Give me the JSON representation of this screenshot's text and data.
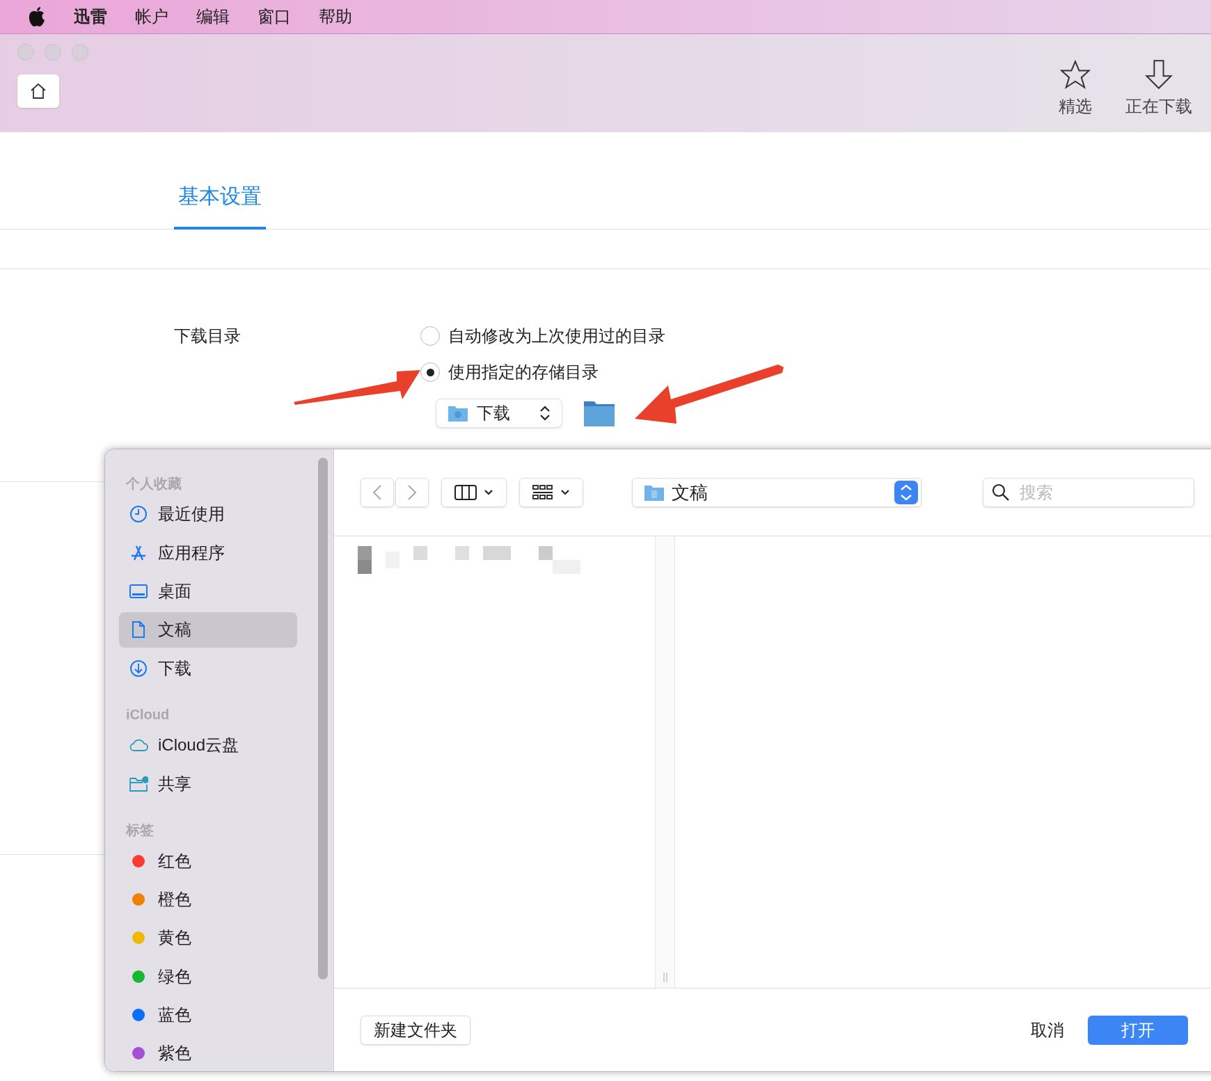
{
  "menu_bar": {
    "app_name": "迅雷",
    "menus": [
      "帐户",
      "编辑",
      "窗口",
      "帮助"
    ]
  },
  "toolbar": {
    "buttons": [
      {
        "label": "精选",
        "kind": "star"
      },
      {
        "label": "正在下载",
        "kind": "download"
      }
    ]
  },
  "tabs": [
    {
      "label": "基本设置",
      "selected": true
    }
  ],
  "settings": {
    "label": "下载目录",
    "options": [
      {
        "label": "自动修改为上次使用过的目录",
        "selected": false
      },
      {
        "label": "使用指定的存储目录",
        "selected": true
      }
    ],
    "folder_popup": {
      "value": "下载"
    }
  },
  "dialog": {
    "sidebar": [
      {
        "title": "个人收藏",
        "items": [
          {
            "label": "最近使用",
            "kind": "clock",
            "selected": false
          },
          {
            "label": "应用程序",
            "kind": "apps",
            "selected": false
          },
          {
            "label": "桌面",
            "kind": "desktop",
            "selected": false
          },
          {
            "label": "文稿",
            "kind": "document",
            "selected": true
          },
          {
            "label": "下载",
            "kind": "download",
            "selected": false
          }
        ]
      },
      {
        "title": "iCloud",
        "items": [
          {
            "label": "iCloud云盘",
            "kind": "cloud",
            "selected": false
          },
          {
            "label": "共享",
            "kind": "shared",
            "selected": false
          }
        ]
      },
      {
        "title": "标签",
        "items": [
          {
            "label": "红色",
            "kind": "tag",
            "color": "#fe3b30",
            "selected": false
          },
          {
            "label": "橙色",
            "kind": "tag",
            "color": "#f08100",
            "selected": false
          },
          {
            "label": "黄色",
            "kind": "tag",
            "color": "#f0b800",
            "selected": false
          },
          {
            "label": "绿色",
            "kind": "tag",
            "color": "#18b832",
            "selected": false
          },
          {
            "label": "蓝色",
            "kind": "tag",
            "color": "#0a6efe",
            "selected": false
          },
          {
            "label": "紫色",
            "kind": "tag",
            "color": "#a550d4",
            "selected": false
          }
        ]
      }
    ],
    "location": "文稿",
    "search": {
      "placeholder": "搜索"
    },
    "buttons": {
      "new_folder": "新建文件夹",
      "cancel": "取消",
      "open": "打开"
    }
  }
}
